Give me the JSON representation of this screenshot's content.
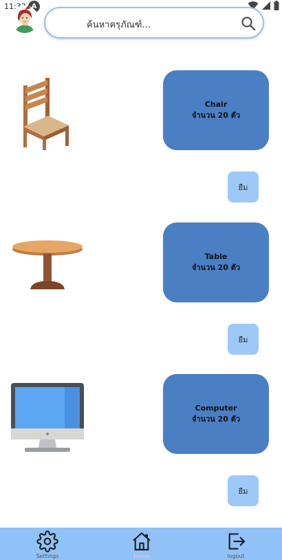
{
  "status_bar": {
    "time": "11:33",
    "notification_letter": "A"
  },
  "search": {
    "placeholder": "ค้นหาครุภัณฑ์..."
  },
  "items": [
    {
      "name": "Chair",
      "quantity_text": "จำนวน 20 ตัว",
      "borrow_label": "ยืม",
      "icon": "chair-image"
    },
    {
      "name": "Table",
      "quantity_text": "จำนวน 20 ตัว",
      "borrow_label": "ยืม",
      "icon": "table-image"
    },
    {
      "name": "Computer",
      "quantity_text": "จำนวน 20 ตัว",
      "borrow_label": "ยืม",
      "icon": "computer-image"
    }
  ],
  "bottom_nav": [
    {
      "label": "Settings",
      "icon": "gear-icon",
      "active": false
    },
    {
      "label": "Home",
      "icon": "home-icon",
      "active": true
    },
    {
      "label": "logout",
      "icon": "logout-icon",
      "active": false
    }
  ],
  "colors": {
    "card": "#4a7fc4",
    "borrow_button": "#9ec9f7",
    "bottom_nav": "#90c2f7",
    "search_border": "#9cc0ea"
  }
}
